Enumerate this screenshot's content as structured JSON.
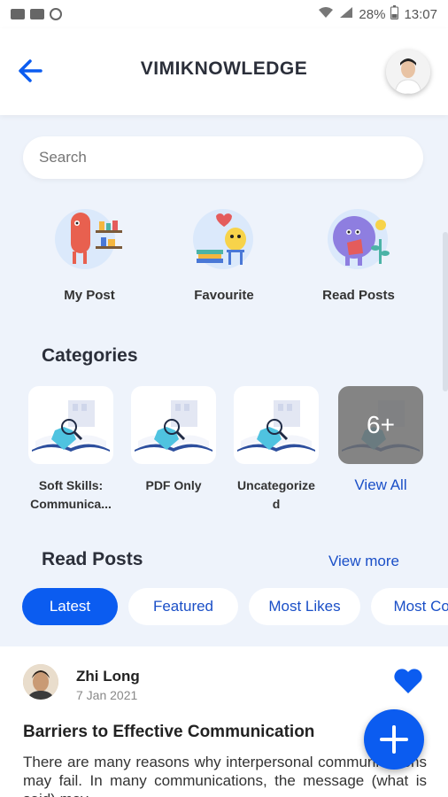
{
  "status_bar": {
    "battery": "28%",
    "time": "13:07"
  },
  "header": {
    "title": "VIMIKNOWLEDGE"
  },
  "search": {
    "placeholder": "Search"
  },
  "quick_actions": [
    {
      "label": "My Post",
      "icon": "my-post-illustration"
    },
    {
      "label": "Favourite",
      "icon": "favourite-illustration"
    },
    {
      "label": "Read Posts",
      "icon": "read-posts-illustration"
    }
  ],
  "categories": {
    "title": "Categories",
    "items": [
      {
        "label": "Soft Skills: Communica..."
      },
      {
        "label": "PDF Only"
      },
      {
        "label": "Uncategorize d"
      }
    ],
    "more_count": "6+",
    "view_all_label": "View All"
  },
  "read_posts": {
    "title": "Read Posts",
    "view_more_label": "View more",
    "tabs": [
      "Latest",
      "Featured",
      "Most Likes",
      "Most Cor"
    ],
    "active_tab": "Latest"
  },
  "post": {
    "author": "Zhi Long",
    "date": "7 Jan 2021",
    "title": "Barriers to Effective Communication",
    "body": "There are many reasons why interpersonal communications may fail. In many communications, the message (what is said) may"
  },
  "colors": {
    "accent": "#0b5cf0",
    "link": "#1a4fc7",
    "background": "#eef3fb"
  }
}
